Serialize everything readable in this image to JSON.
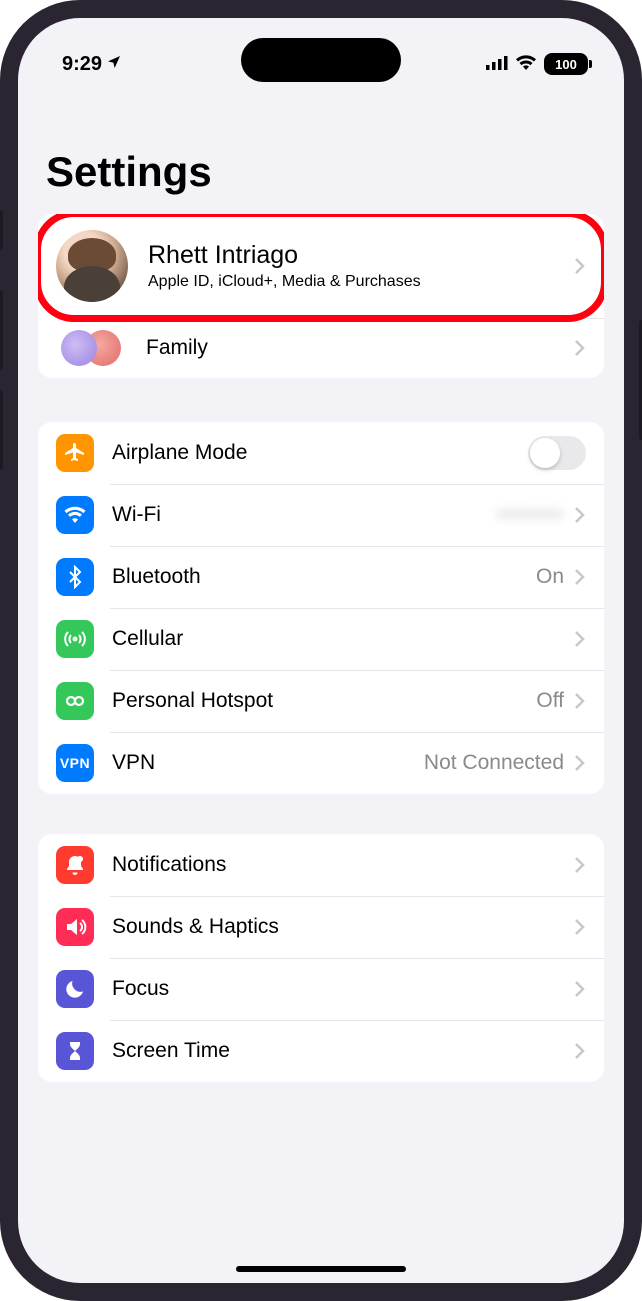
{
  "status": {
    "time": "9:29",
    "battery": "100"
  },
  "page": {
    "title": "Settings"
  },
  "profile": {
    "name": "Rhett Intriago",
    "subtitle": "Apple ID, iCloud+, Media & Purchases"
  },
  "family": {
    "label": "Family"
  },
  "group_network": {
    "airplane": {
      "label": "Airplane Mode"
    },
    "wifi": {
      "label": "Wi-Fi",
      "value": "••••••••"
    },
    "bt": {
      "label": "Bluetooth",
      "value": "On"
    },
    "cell": {
      "label": "Cellular"
    },
    "hotspot": {
      "label": "Personal Hotspot",
      "value": "Off"
    },
    "vpn": {
      "label": "VPN",
      "badge": "VPN",
      "value": "Not Connected"
    }
  },
  "group_system": {
    "notif": {
      "label": "Notifications"
    },
    "sounds": {
      "label": "Sounds & Haptics"
    },
    "focus": {
      "label": "Focus"
    },
    "screen": {
      "label": "Screen Time"
    }
  },
  "colors": {
    "orange": "#ff9500",
    "blue": "#007aff",
    "green": "#34c759",
    "red": "#ff3b30",
    "indigo": "#5856d6"
  }
}
